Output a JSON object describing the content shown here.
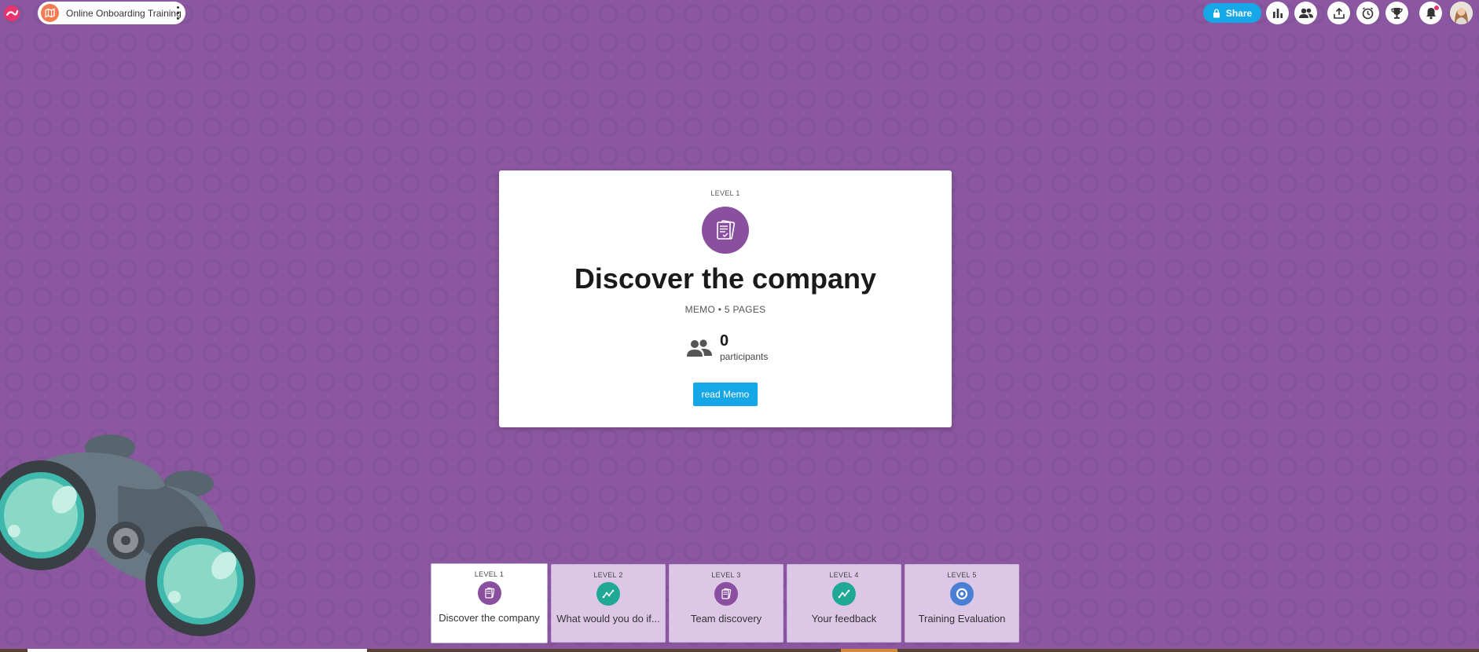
{
  "header": {
    "project_title": "Online Onboarding Training",
    "share_label": "Share",
    "icons": [
      "analytics-icon",
      "participants-icon",
      "export-icon",
      "timer-icon",
      "trophy-icon",
      "notification-bell-icon",
      "user-avatar"
    ]
  },
  "card": {
    "level_label": "LEVEL 1",
    "icon": "memo-icon",
    "title": "Discover the company",
    "subtitle": "MEMO • 5 PAGES",
    "participants_count": "0",
    "participants_label": "participants",
    "action_label": "read Memo"
  },
  "levels": [
    {
      "level": "LEVEL 1",
      "title": "Discover the company",
      "icon": "memo-icon",
      "color": "#8a4f9e",
      "active": true
    },
    {
      "level": "LEVEL 2",
      "title": "What would you do if...",
      "icon": "trend-icon",
      "color": "#1fa896",
      "active": false
    },
    {
      "level": "LEVEL 3",
      "title": "Team discovery",
      "icon": "memo-icon",
      "color": "#8a4f9e",
      "active": false
    },
    {
      "level": "LEVEL 4",
      "title": "Your feedback",
      "icon": "trend-icon",
      "color": "#1fa896",
      "active": false
    },
    {
      "level": "LEVEL 5",
      "title": "Training Evaluation",
      "icon": "evaluation-icon",
      "color": "#4b7fd6",
      "active": false
    }
  ],
  "colors": {
    "background": "#8a57a0",
    "accent": "#16a7e9"
  }
}
